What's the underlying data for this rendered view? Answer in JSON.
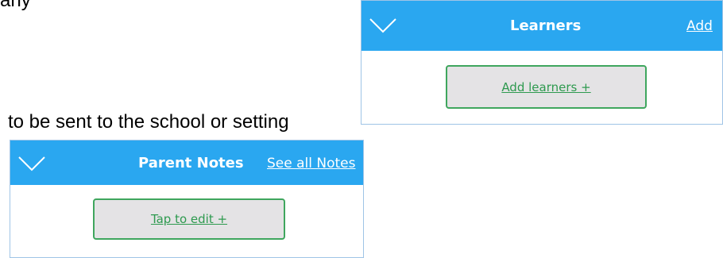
{
  "document": {
    "clipped_text": "any",
    "body_line": "to be sent to the school or setting"
  },
  "learners_panel": {
    "title": "Learners",
    "header_link": "Add",
    "button_label": "Add learners +",
    "chevron_icon": "chevron-down-icon"
  },
  "notes_panel": {
    "title": "Parent Notes",
    "header_link": "See all Notes",
    "button_label": "Tap to edit +",
    "chevron_icon": "chevron-down-icon"
  },
  "colors": {
    "header_bg": "#2aa7f0",
    "button_bg": "#e4e3e5",
    "button_border": "#3fa65e",
    "button_text": "#2e9a4f"
  }
}
